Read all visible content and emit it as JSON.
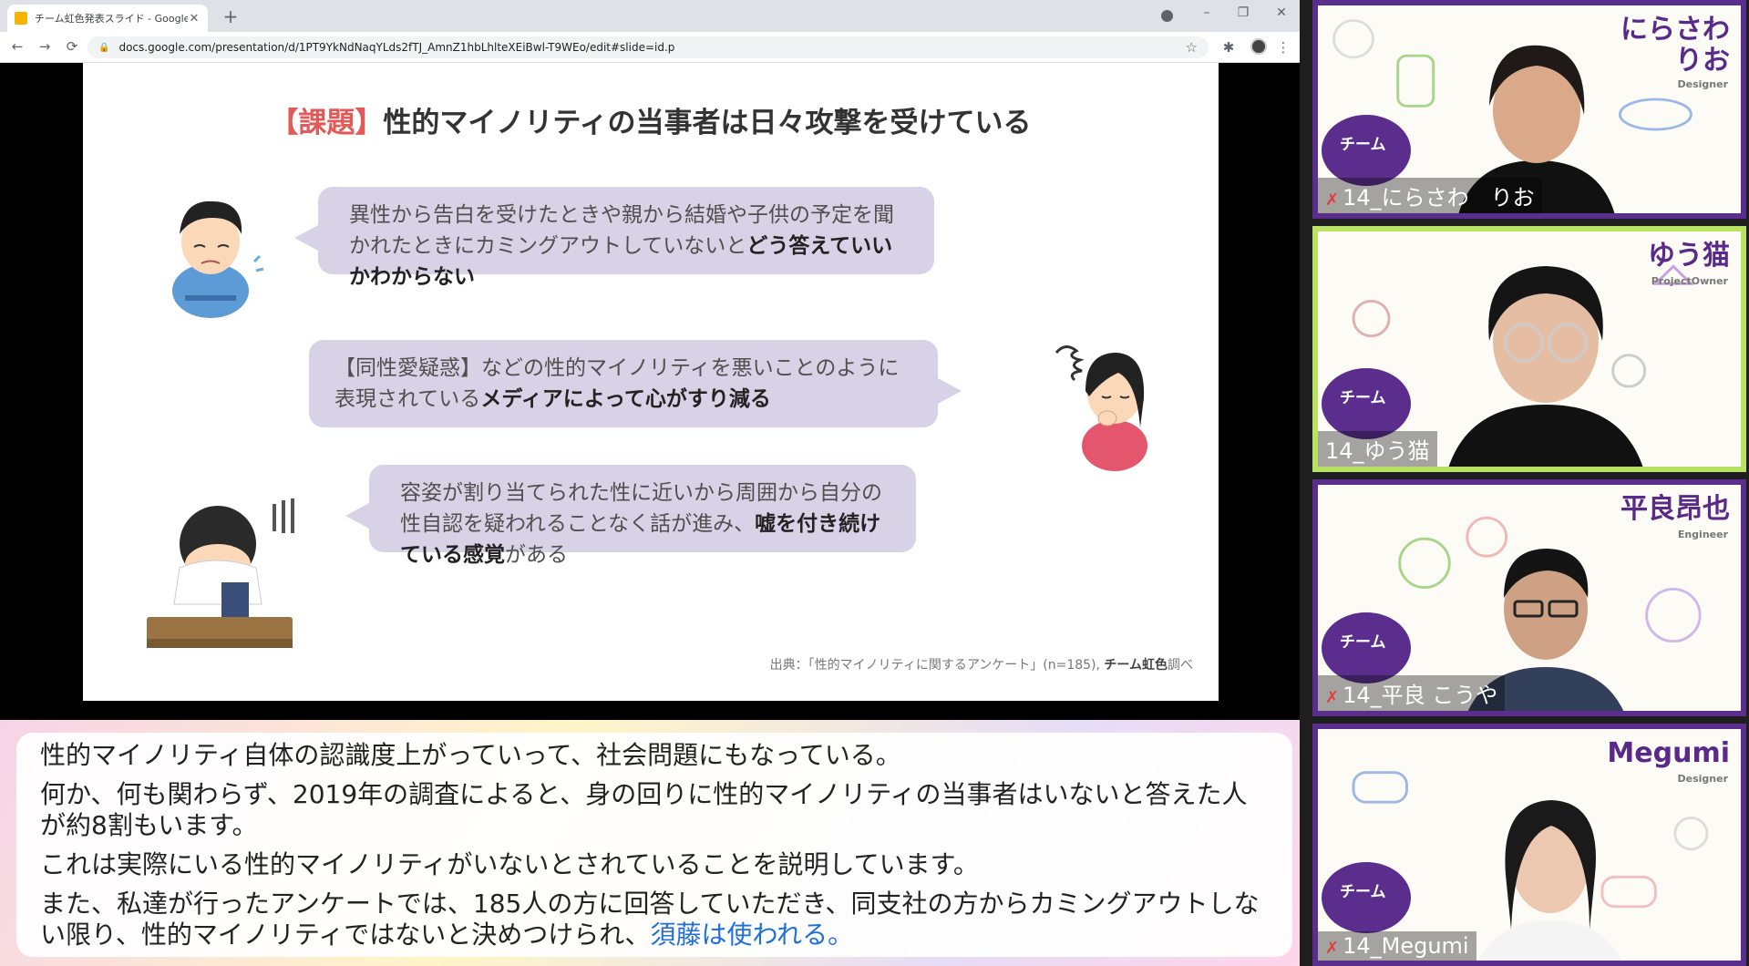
{
  "browser": {
    "tab_title": "チーム虹色発表スライド - Google Sl",
    "new_tab": "+",
    "url": "docs.google.com/presentation/d/1PT9YkNdNaqYLds2fTJ_AmnZ1hbLhlteXEiBwl-T9WEo/edit#slide=id.p",
    "nav": {
      "back": "←",
      "forward": "→",
      "reload": "⟳"
    },
    "window": {
      "minimize": "–",
      "restore": "❐",
      "close": "✕"
    },
    "bookmark": "☆",
    "extensions": "✱",
    "menu": "⋮"
  },
  "slide": {
    "title_bracket": "【課題】",
    "title_rest": "性的マイノリティの当事者は日々攻撃を受けている",
    "bubbles": [
      {
        "normal": "異性から告白を受けたときや親から結婚や子供の予定を聞かれたときにカミングアウトしていないと",
        "bold": "どう答えていいかわからない",
        "after": ""
      },
      {
        "normal": "【同性愛疑惑】などの性的マイノリティを悪いことのように表現されている",
        "bold": "メディアによって心がすり減る",
        "after": ""
      },
      {
        "normal": "容姿が割り当てられた性に近いから周囲から自分の性自認を疑われることなく話が進み、",
        "bold": "嘘を付き続けている感覚",
        "after": "がある"
      }
    ],
    "source_prefix": "出典：「性的マイノリティに関するアンケート」(n=185), ",
    "source_bold": "チーム虹色",
    "source_suffix": "調べ"
  },
  "captions": {
    "lines": [
      "性的マイノリティ自体の認識度上がっていって、社会問題にもなっている。",
      "何か、何も関わらず、2019年の調査によると、身の回りに性的マイノリティの当事者はいないと答えた人が約8割もいます。",
      "これは実際にいる性的マイノリティがいないとされていることを説明しています。",
      "また、私達が行ったアンケートでは、185人の方に回答していただき、同支社の方からカミングアウトしない限り、性的マイノリティではないと決めつけられ、"
    ],
    "highlight": "須藤は使われる。"
  },
  "participants": [
    {
      "name_line1": "にらさわ",
      "name_line2": "りお",
      "role": "Designer",
      "team": "チーム",
      "label": "14_にらさわ　りお",
      "active": false
    },
    {
      "name_line1": "ゆう猫",
      "name_line2": "",
      "role": "ProjectOwner",
      "team": "チーム",
      "label": "14_ゆう猫",
      "active": true
    },
    {
      "name_line1": "平良昂也",
      "name_line2": "",
      "role": "Engineer",
      "team": "チーム",
      "label": "14_平良 こうや",
      "active": false
    },
    {
      "name_line1": "Megumi",
      "name_line2": "",
      "role": "Designer",
      "team": "チーム",
      "label": "14_Megumi",
      "active": false
    }
  ],
  "colors": {
    "bubble": "#d8d2e6",
    "accent_red": "#e05a5a",
    "team_purple": "#5b2e8e",
    "active_border": "#b9e265",
    "caption_highlight": "#1e6fd9"
  }
}
